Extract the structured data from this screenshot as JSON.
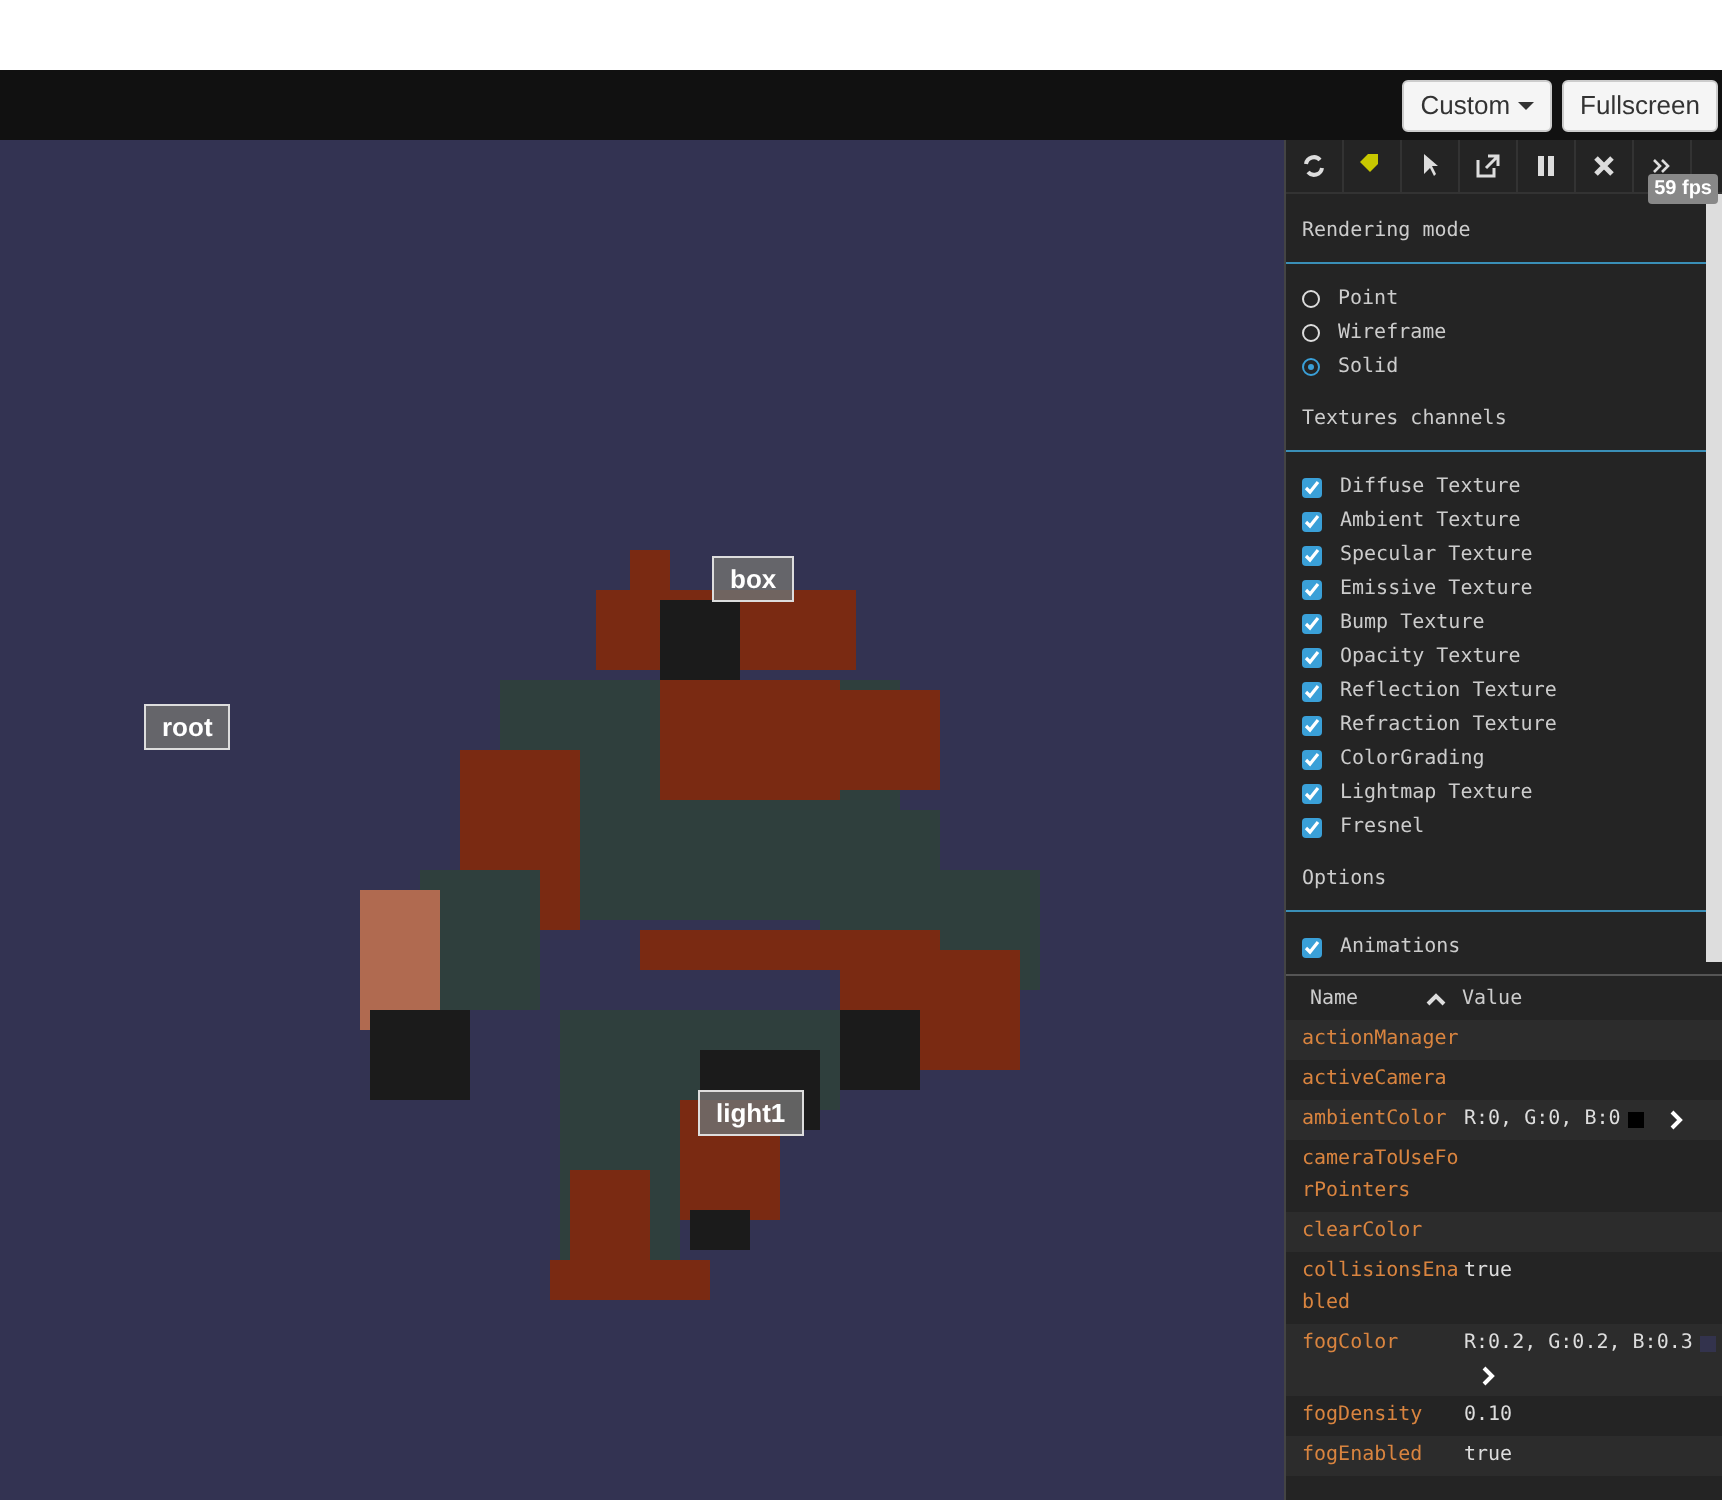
{
  "top_bar": {
    "buttons": [
      {
        "label": "Custom",
        "kind": "dropdown"
      },
      {
        "label": "Fullscreen",
        "kind": "plain"
      }
    ]
  },
  "scene_labels": [
    {
      "text": "box",
      "kind": "mesh"
    },
    {
      "text": "root",
      "kind": "node"
    },
    {
      "text": "light1",
      "kind": "light"
    }
  ],
  "inspector": {
    "fps": "59 fps",
    "rendering_mode": {
      "title": "Rendering mode",
      "options": [
        {
          "label": "Point",
          "selected": false
        },
        {
          "label": "Wireframe",
          "selected": false
        },
        {
          "label": "Solid",
          "selected": true
        }
      ]
    },
    "textures": {
      "title": "Textures channels",
      "items": [
        {
          "label": "Diffuse Texture",
          "checked": true
        },
        {
          "label": "Ambient Texture",
          "checked": true
        },
        {
          "label": "Specular Texture",
          "checked": true
        },
        {
          "label": "Emissive Texture",
          "checked": true
        },
        {
          "label": "Bump Texture",
          "checked": true
        },
        {
          "label": "Opacity Texture",
          "checked": true
        },
        {
          "label": "Reflection Texture",
          "checked": true
        },
        {
          "label": "Refraction Texture",
          "checked": true
        },
        {
          "label": "ColorGrading",
          "checked": true
        },
        {
          "label": "Lightmap Texture",
          "checked": true
        },
        {
          "label": "Fresnel",
          "checked": true
        }
      ]
    },
    "options": {
      "title": "Options",
      "items": [
        {
          "label": "Animations",
          "checked": true
        }
      ]
    },
    "properties": {
      "columns": [
        "Name",
        "Value"
      ],
      "rows": [
        {
          "name": "actionManager"
        },
        {
          "name": "activeCamera"
        },
        {
          "name": "ambientColor",
          "value": "R:0, G:0, B:0",
          "color": "#000000",
          "expandable": true
        },
        {
          "name": "cameraToUseForPointers"
        },
        {
          "name": "clearColor"
        },
        {
          "name": "collisionsEnabled",
          "value": "true"
        },
        {
          "name": "fogColor",
          "value": "R:0.2, G:0.2, B:0.3",
          "color": "#33334d",
          "expandable": true
        },
        {
          "name": "fogDensity",
          "value": "0.10"
        },
        {
          "name": "fogEnabled",
          "value": "true"
        }
      ]
    }
  }
}
